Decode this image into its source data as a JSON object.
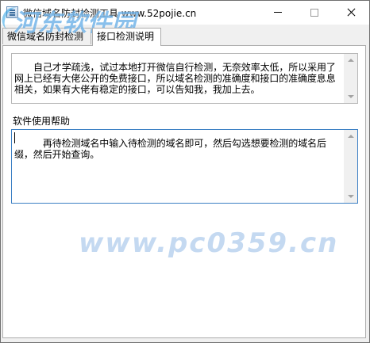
{
  "window": {
    "title": "微信域名防封检测工具 www.52pojie.cn"
  },
  "watermark": {
    "logo_text": "河东软件园",
    "url_text": "www.pc0359.cn"
  },
  "tabs": [
    {
      "label": "微信域名防封检测",
      "active": false
    },
    {
      "label": "接口检测说明",
      "active": true
    }
  ],
  "panel": {
    "description_text": "自己才学疏浅，试过本地打开微信自行检测，无奈效率太低，所以采用了网上已经有大佬公开的免费接口，所以域名检测的准确度和接口的准确度息息相关，如果有大佬有稳定的接口，可以告知我，我加上去。",
    "help_label": "软件使用帮助",
    "help_text": "　再待检测域名中输入待检测的域名即可，然后勾选想要检测的域名后缀，然后开始查询。"
  },
  "icons": {
    "app": "app-window-icon",
    "minimize": "minimize-icon",
    "maximize": "maximize-icon",
    "close": "close-icon"
  }
}
